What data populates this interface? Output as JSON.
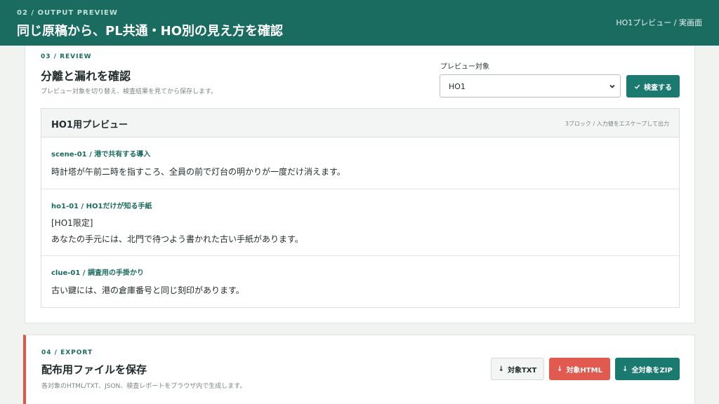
{
  "topbar": {
    "eyebrow": "02 / OUTPUT PREVIEW",
    "title": "同じ原稿から、PL共通・HO別の見え方を確認",
    "right_label": "HO1プレビュー / 実画面"
  },
  "review": {
    "eyebrow": "03 / REVIEW",
    "title": "分離と漏れを確認",
    "description": "プレビュー対象を切り替え、検査結果を見てから保存します。",
    "select_label": "プレビュー対象",
    "select_value": "HO1",
    "check_button": "検査する",
    "preview": {
      "title": "HO1用プレビュー",
      "meta": "3ブロック / 入力値をエスケープして出力",
      "blocks": [
        {
          "header": "scene-01 / 港で共有する導入",
          "lines": [
            "時計塔が午前二時を指すころ、全員の前で灯台の明かりが一度だけ消えます。"
          ]
        },
        {
          "header": "ho1-01 / HO1だけが知る手紙",
          "lines": [
            "[HO1限定]",
            "あなたの手元には、北門で待つよう書かれた古い手紙があります。"
          ]
        },
        {
          "header": "clue-01 / 調査用の手掛かり",
          "lines": [
            "古い鍵には、港の倉庫番号と同じ刻印があります。"
          ]
        }
      ]
    }
  },
  "export": {
    "eyebrow": "04 / EXPORT",
    "title": "配布用ファイルを保存",
    "description": "各対象のHTML/TXT、JSON、検査レポートをブラウザ内で生成します。",
    "buttons": {
      "txt": "対象TXT",
      "html": "対象HTML",
      "zip": "全対象をZIP"
    }
  },
  "icons": {
    "check": "check-icon",
    "download": "download-arrow-icon",
    "chevron": "chevron-down-icon"
  },
  "colors": {
    "brand": "#1a6b60",
    "accent_red": "#e05a4f"
  }
}
